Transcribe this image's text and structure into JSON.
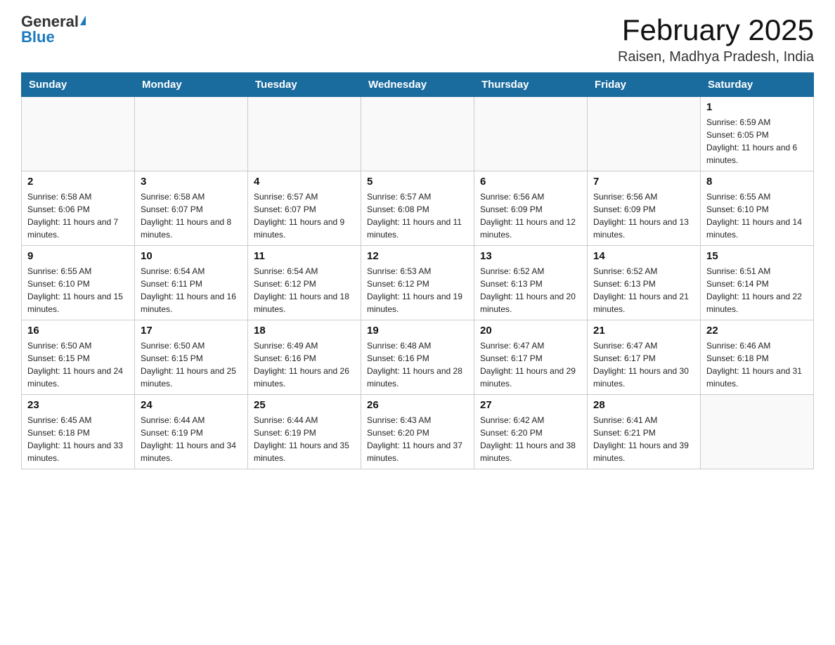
{
  "logo": {
    "general": "General",
    "blue": "Blue"
  },
  "title": "February 2025",
  "subtitle": "Raisen, Madhya Pradesh, India",
  "days_of_week": [
    "Sunday",
    "Monday",
    "Tuesday",
    "Wednesday",
    "Thursday",
    "Friday",
    "Saturday"
  ],
  "weeks": [
    [
      {
        "day": "",
        "info": ""
      },
      {
        "day": "",
        "info": ""
      },
      {
        "day": "",
        "info": ""
      },
      {
        "day": "",
        "info": ""
      },
      {
        "day": "",
        "info": ""
      },
      {
        "day": "",
        "info": ""
      },
      {
        "day": "1",
        "info": "Sunrise: 6:59 AM\nSunset: 6:05 PM\nDaylight: 11 hours and 6 minutes."
      }
    ],
    [
      {
        "day": "2",
        "info": "Sunrise: 6:58 AM\nSunset: 6:06 PM\nDaylight: 11 hours and 7 minutes."
      },
      {
        "day": "3",
        "info": "Sunrise: 6:58 AM\nSunset: 6:07 PM\nDaylight: 11 hours and 8 minutes."
      },
      {
        "day": "4",
        "info": "Sunrise: 6:57 AM\nSunset: 6:07 PM\nDaylight: 11 hours and 9 minutes."
      },
      {
        "day": "5",
        "info": "Sunrise: 6:57 AM\nSunset: 6:08 PM\nDaylight: 11 hours and 11 minutes."
      },
      {
        "day": "6",
        "info": "Sunrise: 6:56 AM\nSunset: 6:09 PM\nDaylight: 11 hours and 12 minutes."
      },
      {
        "day": "7",
        "info": "Sunrise: 6:56 AM\nSunset: 6:09 PM\nDaylight: 11 hours and 13 minutes."
      },
      {
        "day": "8",
        "info": "Sunrise: 6:55 AM\nSunset: 6:10 PM\nDaylight: 11 hours and 14 minutes."
      }
    ],
    [
      {
        "day": "9",
        "info": "Sunrise: 6:55 AM\nSunset: 6:10 PM\nDaylight: 11 hours and 15 minutes."
      },
      {
        "day": "10",
        "info": "Sunrise: 6:54 AM\nSunset: 6:11 PM\nDaylight: 11 hours and 16 minutes."
      },
      {
        "day": "11",
        "info": "Sunrise: 6:54 AM\nSunset: 6:12 PM\nDaylight: 11 hours and 18 minutes."
      },
      {
        "day": "12",
        "info": "Sunrise: 6:53 AM\nSunset: 6:12 PM\nDaylight: 11 hours and 19 minutes."
      },
      {
        "day": "13",
        "info": "Sunrise: 6:52 AM\nSunset: 6:13 PM\nDaylight: 11 hours and 20 minutes."
      },
      {
        "day": "14",
        "info": "Sunrise: 6:52 AM\nSunset: 6:13 PM\nDaylight: 11 hours and 21 minutes."
      },
      {
        "day": "15",
        "info": "Sunrise: 6:51 AM\nSunset: 6:14 PM\nDaylight: 11 hours and 22 minutes."
      }
    ],
    [
      {
        "day": "16",
        "info": "Sunrise: 6:50 AM\nSunset: 6:15 PM\nDaylight: 11 hours and 24 minutes."
      },
      {
        "day": "17",
        "info": "Sunrise: 6:50 AM\nSunset: 6:15 PM\nDaylight: 11 hours and 25 minutes."
      },
      {
        "day": "18",
        "info": "Sunrise: 6:49 AM\nSunset: 6:16 PM\nDaylight: 11 hours and 26 minutes."
      },
      {
        "day": "19",
        "info": "Sunrise: 6:48 AM\nSunset: 6:16 PM\nDaylight: 11 hours and 28 minutes."
      },
      {
        "day": "20",
        "info": "Sunrise: 6:47 AM\nSunset: 6:17 PM\nDaylight: 11 hours and 29 minutes."
      },
      {
        "day": "21",
        "info": "Sunrise: 6:47 AM\nSunset: 6:17 PM\nDaylight: 11 hours and 30 minutes."
      },
      {
        "day": "22",
        "info": "Sunrise: 6:46 AM\nSunset: 6:18 PM\nDaylight: 11 hours and 31 minutes."
      }
    ],
    [
      {
        "day": "23",
        "info": "Sunrise: 6:45 AM\nSunset: 6:18 PM\nDaylight: 11 hours and 33 minutes."
      },
      {
        "day": "24",
        "info": "Sunrise: 6:44 AM\nSunset: 6:19 PM\nDaylight: 11 hours and 34 minutes."
      },
      {
        "day": "25",
        "info": "Sunrise: 6:44 AM\nSunset: 6:19 PM\nDaylight: 11 hours and 35 minutes."
      },
      {
        "day": "26",
        "info": "Sunrise: 6:43 AM\nSunset: 6:20 PM\nDaylight: 11 hours and 37 minutes."
      },
      {
        "day": "27",
        "info": "Sunrise: 6:42 AM\nSunset: 6:20 PM\nDaylight: 11 hours and 38 minutes."
      },
      {
        "day": "28",
        "info": "Sunrise: 6:41 AM\nSunset: 6:21 PM\nDaylight: 11 hours and 39 minutes."
      },
      {
        "day": "",
        "info": ""
      }
    ]
  ]
}
